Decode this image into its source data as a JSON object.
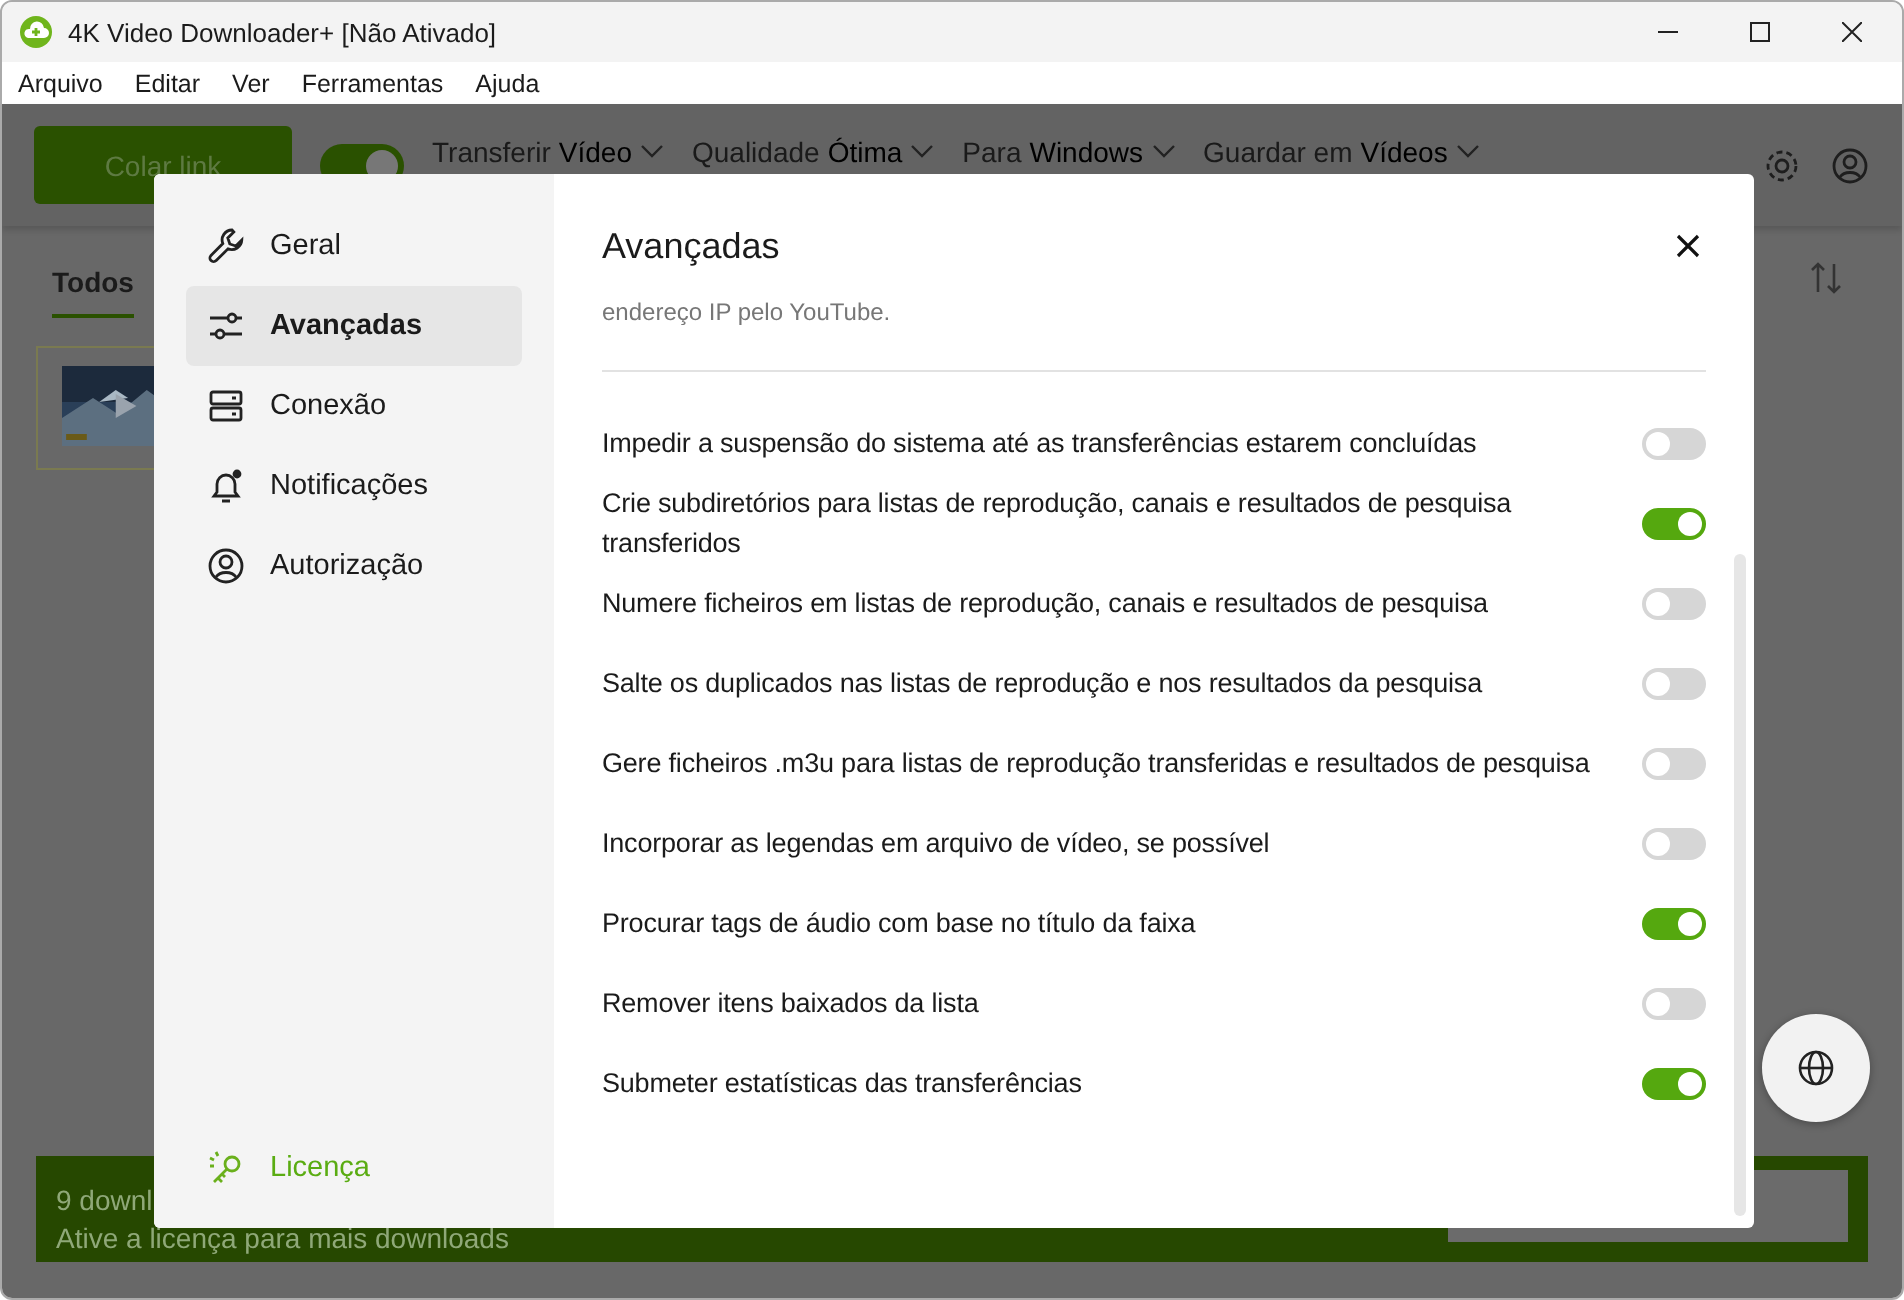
{
  "window": {
    "title": "4K Video Downloader+ [Não Ativado]"
  },
  "menu": [
    "Arquivo",
    "Editar",
    "Ver",
    "Ferramentas",
    "Ajuda"
  ],
  "toolbar": {
    "paste_button": "Colar link",
    "smart_mode_on": true,
    "dropdowns": [
      {
        "label": "Transferir",
        "value": "Vídeo"
      },
      {
        "label": "Qualidade",
        "value": "Ótima"
      },
      {
        "label": "Para",
        "value": "Windows"
      },
      {
        "label": "Guardar em",
        "value": "Vídeos"
      }
    ]
  },
  "tabs": [
    {
      "label": "Todos",
      "selected": true
    }
  ],
  "banner": {
    "title": "9 downl",
    "subtitle": "Ative a licença para mais downloads"
  },
  "settings": {
    "nav": [
      {
        "label": "Geral",
        "selected": false
      },
      {
        "label": "Avançadas",
        "selected": true
      },
      {
        "label": "Conexão",
        "selected": false
      },
      {
        "label": "Notificações",
        "selected": false
      },
      {
        "label": "Autorização",
        "selected": false
      }
    ],
    "license_link": "Licença",
    "title": "Avançadas",
    "note": "endereço IP pelo YouTube.",
    "options": [
      {
        "label": "Impedir a suspensão do sistema até as transferências estarem concluídas",
        "on": false
      },
      {
        "label": "Crie subdiretórios para listas de reprodução, canais e resultados de pesquisa transferidos",
        "on": true
      },
      {
        "label": "Numere ficheiros em listas de reprodução, canais e resultados de pesquisa",
        "on": false
      },
      {
        "label": "Salte os duplicados nas listas de reprodução e nos resultados da pesquisa",
        "on": false
      },
      {
        "label": "Gere ficheiros .m3u para listas de reprodução transferidas e resultados de pesquisa",
        "on": false
      },
      {
        "label": "Incorporar as legendas em arquivo de vídeo, se possível",
        "on": false
      },
      {
        "label": "Procurar tags de áudio com base no título da faixa",
        "on": true
      },
      {
        "label": "Remover itens baixados da lista",
        "on": false
      },
      {
        "label": "Submeter estatísticas das transferências",
        "on": true
      }
    ]
  }
}
